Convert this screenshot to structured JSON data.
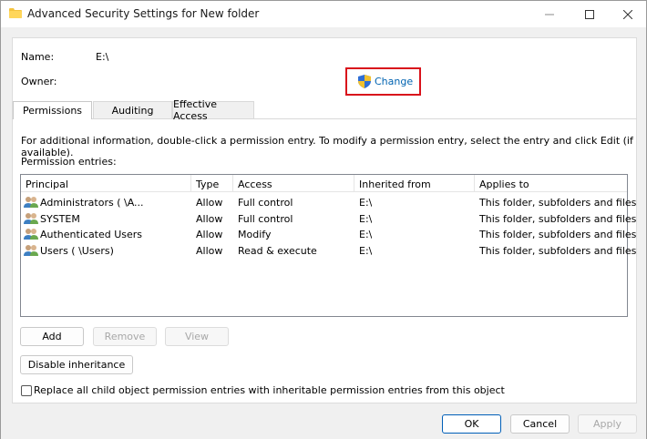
{
  "window": {
    "title": "Advanced Security Settings for New folder"
  },
  "fields": {
    "name_label": "Name:",
    "name_value": "E:\\",
    "owner_label": "Owner:",
    "change_link": "Change"
  },
  "tabs": [
    {
      "label": "Permissions",
      "active": true
    },
    {
      "label": "Auditing",
      "active": false
    },
    {
      "label": "Effective Access",
      "active": false
    }
  ],
  "info_text": "For additional information, double-click a permission entry. To modify a permission entry, select the entry and click Edit (if available).",
  "permission_entries_label": "Permission entries:",
  "table": {
    "columns": [
      "Principal",
      "Type",
      "Access",
      "Inherited from",
      "Applies to"
    ],
    "rows": [
      {
        "principal": "Administrators (                    \\A...",
        "type": "Allow",
        "access": "Full control",
        "inherited": "E:\\",
        "applies": "This folder, subfolders and files"
      },
      {
        "principal": "SYSTEM",
        "type": "Allow",
        "access": "Full control",
        "inherited": "E:\\",
        "applies": "This folder, subfolders and files"
      },
      {
        "principal": "Authenticated Users",
        "type": "Allow",
        "access": "Modify",
        "inherited": "E:\\",
        "applies": "This folder, subfolders and files"
      },
      {
        "principal": "Users (                   \\Users)",
        "type": "Allow",
        "access": "Read & execute",
        "inherited": "E:\\",
        "applies": "This folder, subfolders and files"
      }
    ]
  },
  "buttons": {
    "add": "Add",
    "remove": "Remove",
    "view": "View",
    "disable_inheritance": "Disable inheritance",
    "ok": "OK",
    "cancel": "Cancel",
    "apply": "Apply"
  },
  "replace_checkbox_label": "Replace all child object permission entries with inheritable permission entries from this object",
  "colors": {
    "highlight_box": "#d9121b",
    "link": "#0063b1",
    "primary_border": "#005fb8"
  }
}
